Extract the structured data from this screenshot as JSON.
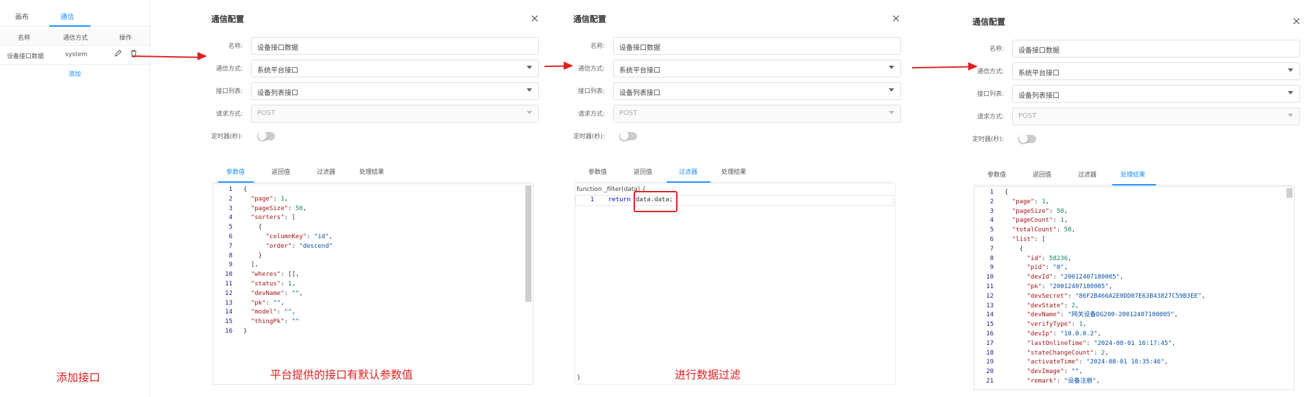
{
  "left": {
    "tabs": [
      "画布",
      "通信"
    ],
    "table_headers": [
      "名称",
      "通信方式",
      "操作"
    ],
    "row": {
      "name": "设备接口数据",
      "method": "system"
    },
    "add_label": "添加",
    "caption": "添加接口"
  },
  "dialog": {
    "title": "通信配置",
    "close": "×",
    "labels": {
      "name": "名称:",
      "method": "通信方式:",
      "api": "接口列表:",
      "request": "请求方式:",
      "timer": "定时器(秒):"
    },
    "values": {
      "name": "设备接口数据",
      "method": "系统平台接口",
      "api": "设备列表接口",
      "request": "POST"
    },
    "tabs": [
      "参数值",
      "返回值",
      "过滤器",
      "处理结果"
    ]
  },
  "panel1": {
    "active_tab": "参数值",
    "caption": "平台提供的接口有默认参数值",
    "lines": [
      "{",
      "  \"page\": 1,",
      "  \"pageSize\": 50,",
      "  \"sorters\": [",
      "    {",
      "      \"columnKey\": \"id\",",
      "      \"order\": \"descend\"",
      "    }",
      "  ],",
      "  \"wheres\": [],",
      "  \"status\": 1,",
      "  \"devName\": \"\",",
      "  \"pk\": \"\",",
      "  \"model\": \"\",",
      "  \"thingPk\": \"\"",
      "}"
    ]
  },
  "panel2": {
    "active_tab": "过滤器",
    "caption": "进行数据过滤",
    "func_header": "function _filter(data) {",
    "line_no": "1",
    "keyword": "return",
    "expr": "data.data;",
    "footer": "}"
  },
  "panel3": {
    "active_tab": "处理结果",
    "lines": [
      "{",
      "  \"page\": 1,",
      "  \"pageSize\": 50,",
      "  \"pageCount\": 1,",
      "  \"totalCount\": 50,",
      "  \"list\": [",
      "    {",
      "      \"id\": 58236,",
      "      \"pid\": \"0\",",
      "      \"devId\": \"20012407180005\",",
      "      \"pk\": \"20012407180005\",",
      "      \"devSecret\": \"86F2B466A2E0DD07E63B43827C59B3EE\",",
      "      \"devState\": 2,",
      "      \"devName\": \"网关设备DG200-20012407180005\",",
      "      \"verifyType\": 1,",
      "      \"devIp\": \"10.0.0.2\",",
      "      \"lastOnlineTime\": \"2024-08-01 16:17:45\",",
      "      \"stateChangeCount\": 2,",
      "      \"activateTime\": \"2024-08-01 10:35:46\",",
      "      \"devImage\": \"\",",
      "      \"remark\": \"设备注册\","
    ]
  },
  "colors": {
    "accent": "#1890ff",
    "annotation": "#e02020"
  }
}
